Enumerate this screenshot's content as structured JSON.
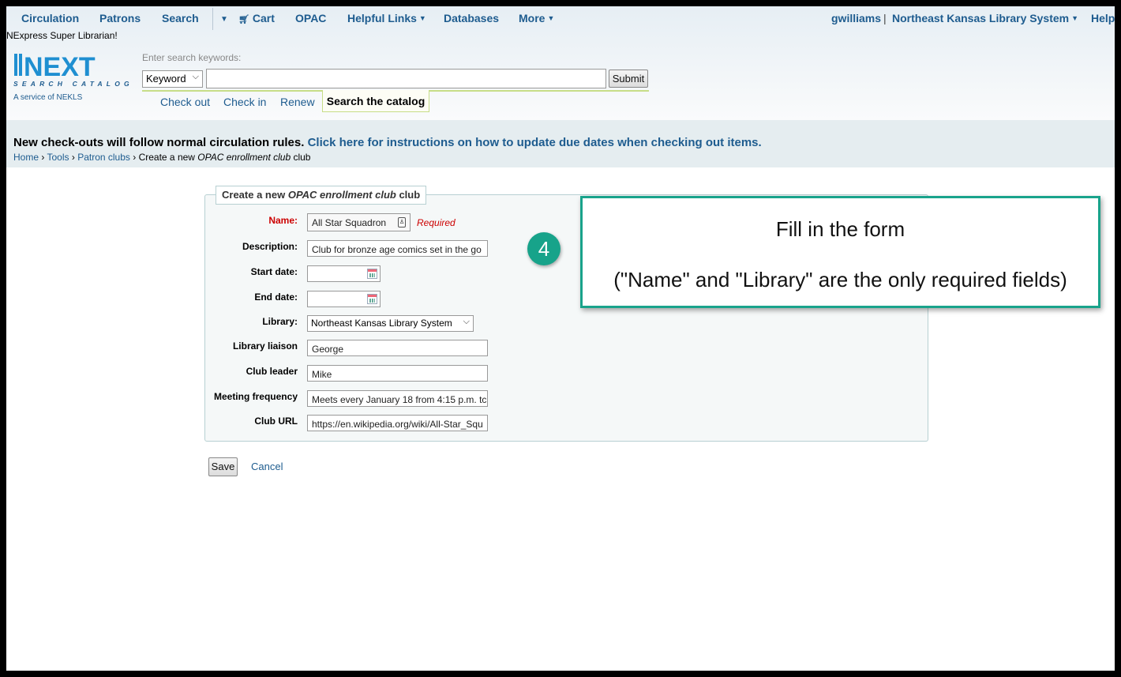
{
  "topnav": {
    "circulation": "Circulation",
    "patrons": "Patrons",
    "search": "Search",
    "cart": "Cart",
    "opac": "OPAC",
    "helpful_links": "Helpful Links",
    "databases": "Databases",
    "more": "More",
    "user": "gwilliams",
    "separator": "|",
    "library": "Northeast Kansas Library System",
    "help": "Help"
  },
  "welcome_text": "NExpress Super Librarian!",
  "logo": {
    "word": "NEXT",
    "tagline": "SEARCH CATALOG",
    "service": "A service of NEKLS"
  },
  "search": {
    "label": "Enter search keywords:",
    "type": "Keyword",
    "query": "",
    "submit": "Submit"
  },
  "subtabs": {
    "check_out": "Check out",
    "check_in": "Check in",
    "renew": "Renew",
    "search_catalog": "Search the catalog"
  },
  "notice": {
    "text": "New check-outs will follow normal circulation rules.",
    "link": "Click here for instructions on how to update due dates when checking out items."
  },
  "breadcrumb": {
    "home": "Home",
    "tools": "Tools",
    "patron_clubs": "Patron clubs",
    "sep": "›",
    "current_prefix": "Create a new",
    "current_em": "OPAC enrollment club",
    "current_suffix": "club"
  },
  "form": {
    "legend_prefix": "Create a new",
    "legend_em": "OPAC enrollment club",
    "legend_suffix": "club",
    "name_label": "Name:",
    "name_value": "All Star Squadron",
    "required_note": "Required",
    "description_label": "Description:",
    "description_value": "Club for bronze age comics set in the go",
    "start_date_label": "Start date:",
    "start_date_value": "",
    "end_date_label": "End date:",
    "end_date_value": "",
    "library_label": "Library:",
    "library_value": "Northeast Kansas Library System",
    "liaison_label": "Library liaison",
    "liaison_value": "George",
    "leader_label": "Club leader",
    "leader_value": "Mike",
    "frequency_label": "Meeting frequency",
    "frequency_value": "Meets every January 18 from 4:15 p.m. tc",
    "url_label": "Club URL",
    "url_value": "https://en.wikipedia.org/wiki/All-Star_Squ",
    "save": "Save",
    "cancel": "Cancel"
  },
  "callout": {
    "step": "4",
    "line1": "Fill in the form",
    "line2": "(\"Name\" and \"Library\" are the only required fields)",
    "border_color": "#19a38b"
  },
  "colors": {
    "link": "#1e5c8f",
    "required": "#cc0000",
    "accent_green": "#c7dd88"
  }
}
